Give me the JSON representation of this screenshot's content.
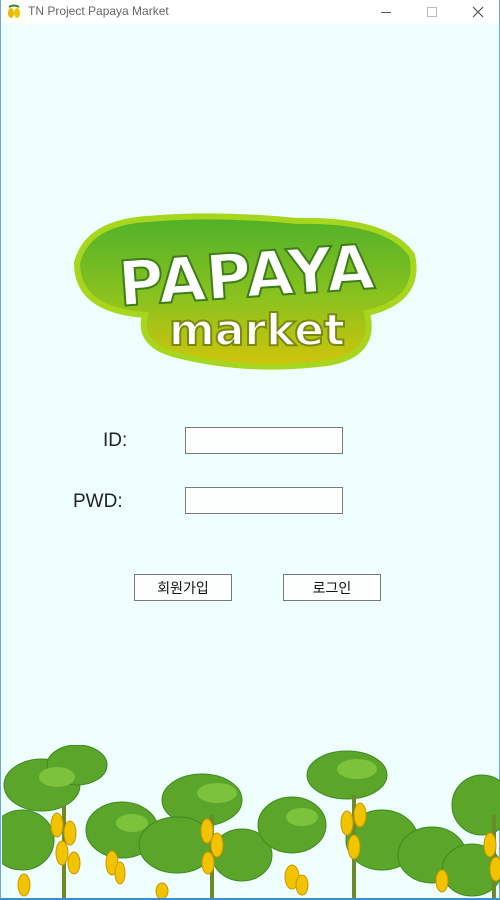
{
  "window": {
    "title": "TN Project Papaya Market",
    "icon": "papaya-app-icon",
    "controls": [
      "minimize-icon",
      "maximize-icon",
      "close-icon"
    ]
  },
  "logo": {
    "line1": "PAPAYA",
    "line2": "market",
    "colors": {
      "top": "#4caf2a",
      "bottom": "#c8c20c",
      "outline": "#ffffff",
      "glow": "#b6d81c"
    }
  },
  "form": {
    "id_label": "ID:",
    "id_value": "",
    "pwd_label": "PWD:",
    "pwd_value": ""
  },
  "buttons": {
    "signup": "회원가입",
    "login": "로그인"
  },
  "decoration": {
    "plants": "papaya-trees"
  }
}
